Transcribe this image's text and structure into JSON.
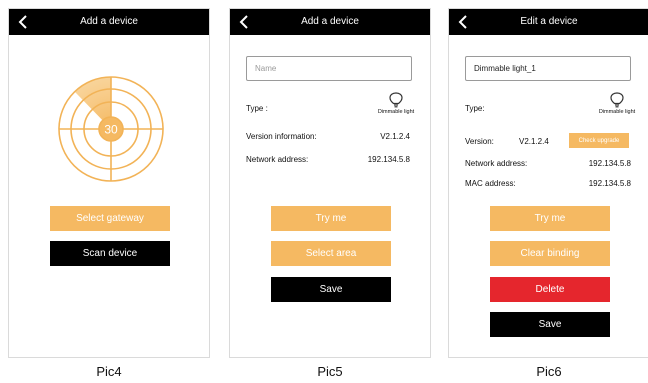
{
  "colors": {
    "accent": "#f5b962",
    "dark": "#000000",
    "danger": "#e5262d"
  },
  "icons": {
    "back": "chevron-left-icon",
    "light": "light-bulb-icon"
  },
  "pic4": {
    "title": "Add a device",
    "radar_value": "30",
    "select_gateway": "Select gateway",
    "scan_device": "Scan device",
    "caption": "Pic4"
  },
  "pic5": {
    "title": "Add a device",
    "name_placeholder": "Name",
    "type_label": "Type :",
    "type_value": "Dimmable light",
    "version_label": "Version information:",
    "version_value": "V2.1.2.4",
    "network_label": "Network address:",
    "network_value": "192.134.5.8",
    "try_me": "Try me",
    "select_area": "Select area",
    "save": "Save",
    "caption": "Pic5"
  },
  "pic6": {
    "title": "Edit a device",
    "name_value": "Dimmable light_1",
    "type_label": "Type:",
    "type_value": "Dimmable light",
    "version_label": "Version:",
    "version_value": "V2.1.2.4",
    "check_upgrade": "Check upgrade",
    "network_label": "Network address:",
    "network_value": "192.134.5.8",
    "mac_label": "MAC address:",
    "mac_value": "192.134.5.8",
    "try_me": "Try me",
    "clear_binding": "Clear binding",
    "delete": "Delete",
    "save": "Save",
    "caption": "Pic6"
  }
}
